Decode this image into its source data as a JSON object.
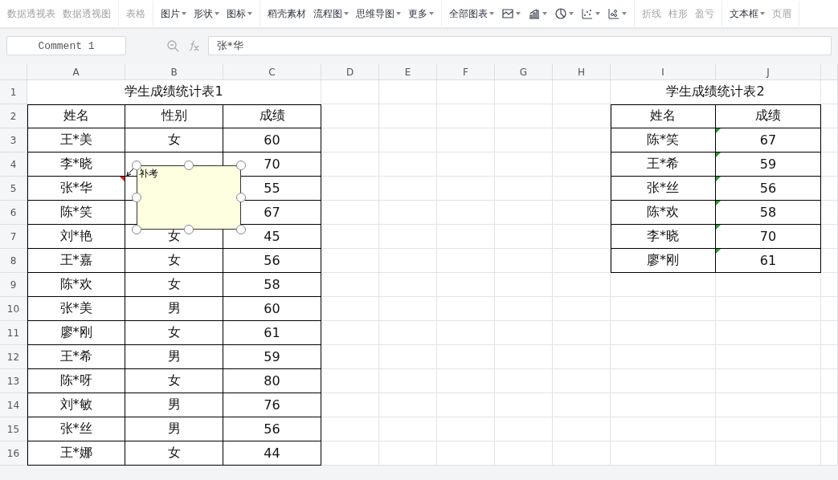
{
  "toolbar": {
    "groups": [
      {
        "items": [
          {
            "label": "数据透视表",
            "disabled": true,
            "dropdown": false
          },
          {
            "label": "数据透视图",
            "disabled": true,
            "dropdown": false
          }
        ]
      },
      {
        "items": [
          {
            "label": "表格",
            "disabled": true,
            "dropdown": false
          }
        ]
      },
      {
        "items": [
          {
            "label": "图片",
            "disabled": false,
            "dropdown": true
          },
          {
            "label": "形状",
            "disabled": false,
            "dropdown": true
          },
          {
            "label": "图标",
            "disabled": false,
            "dropdown": true
          }
        ]
      },
      {
        "items": [
          {
            "label": "稻壳素材",
            "disabled": false,
            "dropdown": false
          },
          {
            "label": "流程图",
            "disabled": false,
            "dropdown": true
          },
          {
            "label": "思维导图",
            "disabled": false,
            "dropdown": true
          },
          {
            "label": "更多",
            "disabled": false,
            "dropdown": true
          }
        ]
      },
      {
        "items": [
          {
            "label": "全部图表",
            "disabled": false,
            "dropdown": true,
            "kind": "text"
          },
          {
            "kind": "icon",
            "dropdown": true
          },
          {
            "kind": "icon",
            "dropdown": true
          },
          {
            "kind": "icon",
            "dropdown": true
          },
          {
            "kind": "icon",
            "dropdown": true
          },
          {
            "kind": "icon",
            "dropdown": true
          }
        ]
      },
      {
        "items": [
          {
            "label": "折线",
            "disabled": true,
            "dropdown": false
          },
          {
            "label": "柱形",
            "disabled": true,
            "dropdown": false
          },
          {
            "label": "盈亏",
            "disabled": true,
            "dropdown": false
          }
        ]
      },
      {
        "items": [
          {
            "label": "文本框",
            "disabled": false,
            "dropdown": true
          },
          {
            "label": "页眉",
            "disabled": true,
            "dropdown": false
          }
        ]
      }
    ]
  },
  "formula_bar": {
    "name_box": "Comment 1",
    "formula": "张*华"
  },
  "sheet": {
    "columns": [
      "A",
      "B",
      "C",
      "D",
      "E",
      "F",
      "G",
      "H",
      "I",
      "J"
    ],
    "rows": [
      "1",
      "2",
      "3",
      "4",
      "5",
      "6",
      "7",
      "8",
      "9",
      "10",
      "11",
      "12",
      "13",
      "14",
      "15",
      "16"
    ]
  },
  "table1": {
    "title": "学生成绩统计表1",
    "header": [
      "姓名",
      "性别",
      "成绩"
    ],
    "rows": [
      {
        "name": "王*美",
        "gender": "女",
        "score": "60",
        "comment": false
      },
      {
        "name": "李*晓",
        "gender": null,
        "score": "70",
        "comment": false
      },
      {
        "name": "张*华",
        "gender": null,
        "score": "55",
        "comment": true
      },
      {
        "name": "陈*笑",
        "gender": null,
        "score": "67",
        "comment": false
      },
      {
        "name": "刘*艳",
        "gender": "女",
        "score": "45",
        "comment": false
      },
      {
        "name": "王*嘉",
        "gender": "女",
        "score": "56",
        "comment": false
      },
      {
        "name": "陈*欢",
        "gender": "女",
        "score": "58",
        "comment": false
      },
      {
        "name": "张*美",
        "gender": "男",
        "score": "60",
        "comment": false
      },
      {
        "name": "廖*刚",
        "gender": "女",
        "score": "61",
        "comment": false
      },
      {
        "name": "王*希",
        "gender": "男",
        "score": "59",
        "comment": false
      },
      {
        "name": "陈*呀",
        "gender": "女",
        "score": "80",
        "comment": false
      },
      {
        "name": "刘*敏",
        "gender": "男",
        "score": "76",
        "comment": false
      },
      {
        "name": "张*丝",
        "gender": "男",
        "score": "56",
        "comment": false
      },
      {
        "name": "王*娜",
        "gender": "女",
        "score": "44",
        "comment": false
      }
    ]
  },
  "table2": {
    "title": "学生成绩统计表2",
    "header": [
      "姓名",
      "成绩"
    ],
    "rows": [
      {
        "name": "陈*笑",
        "score": "67",
        "warning": true
      },
      {
        "name": "王*希",
        "score": "59",
        "warning": true
      },
      {
        "name": "张*丝",
        "score": "56",
        "warning": true
      },
      {
        "name": "陈*欢",
        "score": "58",
        "warning": true
      },
      {
        "name": "李*晓",
        "score": "70",
        "warning": true
      },
      {
        "name": "廖*刚",
        "score": "61",
        "warning": true
      }
    ]
  },
  "comment": {
    "text": "补考",
    "selected": true
  }
}
